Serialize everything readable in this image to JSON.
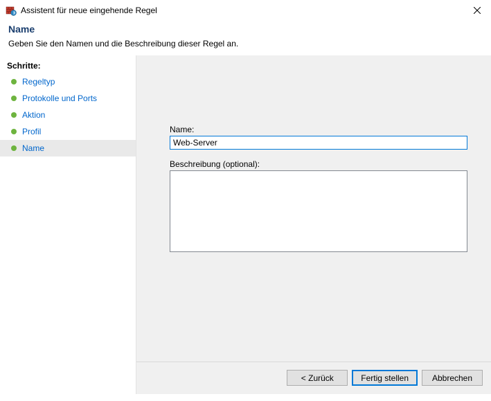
{
  "window": {
    "title": "Assistent für neue eingehende Regel"
  },
  "header": {
    "heading": "Name",
    "subtitle": "Geben Sie den Namen und die Beschreibung dieser Regel an."
  },
  "sidebar": {
    "heading": "Schritte:",
    "items": [
      {
        "label": "Regeltyp"
      },
      {
        "label": "Protokolle und Ports"
      },
      {
        "label": "Aktion"
      },
      {
        "label": "Profil"
      },
      {
        "label": "Name"
      }
    ]
  },
  "form": {
    "name_label": "Name:",
    "name_value": "Web-Server",
    "desc_label": "Beschreibung (optional):",
    "desc_value": ""
  },
  "buttons": {
    "back": "< Zurück",
    "finish": "Fertig stellen",
    "cancel": "Abbrechen"
  }
}
